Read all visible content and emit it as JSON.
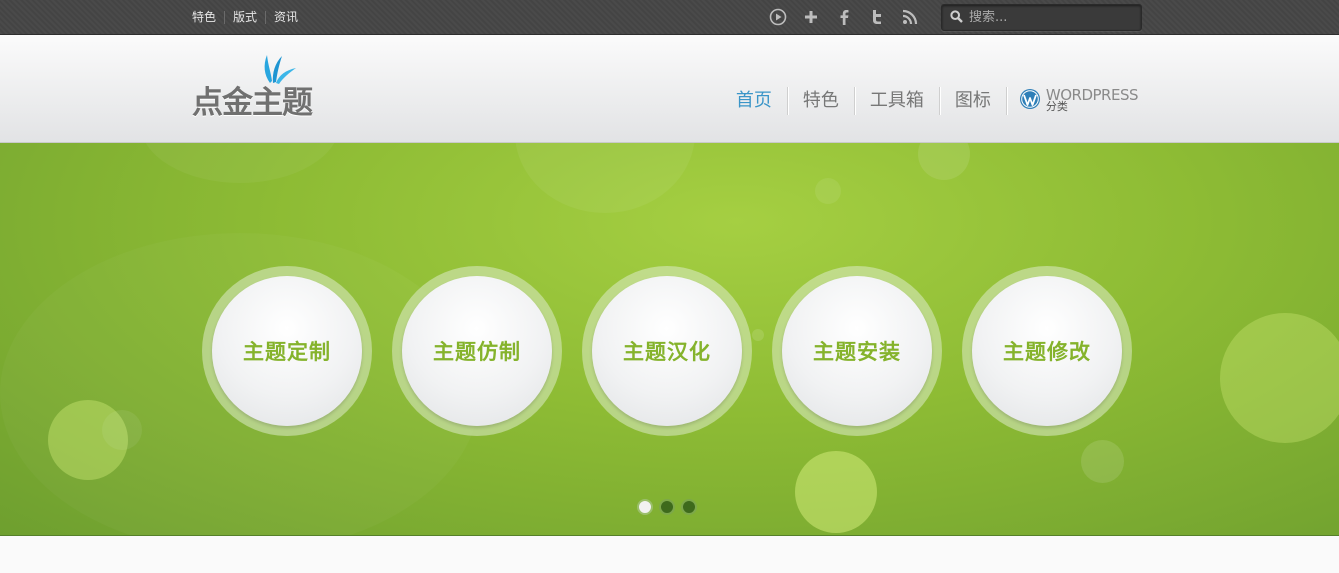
{
  "topbar": {
    "links": [
      "特色",
      "版式",
      "资讯"
    ],
    "social_icons": [
      "play-icon",
      "plus-icon",
      "facebook-icon",
      "twitter-icon",
      "rss-icon"
    ],
    "search_placeholder": "搜索..."
  },
  "header": {
    "logo_text": "点金主题",
    "nav": {
      "items": [
        "首页",
        "特色",
        "工具箱",
        "图标"
      ],
      "active_index": 0,
      "wordpress_title": "WORDPRESS",
      "wordpress_sub": "分类"
    }
  },
  "slider": {
    "circles": [
      "主题定制",
      "主题仿制",
      "主题汉化",
      "主题安装",
      "主题修改"
    ],
    "dots_count": 3,
    "active_dot": 0
  },
  "colors": {
    "accent_blue": "#3b95c8",
    "green_text": "#85b32c",
    "slider_green": "#8dbb34"
  }
}
